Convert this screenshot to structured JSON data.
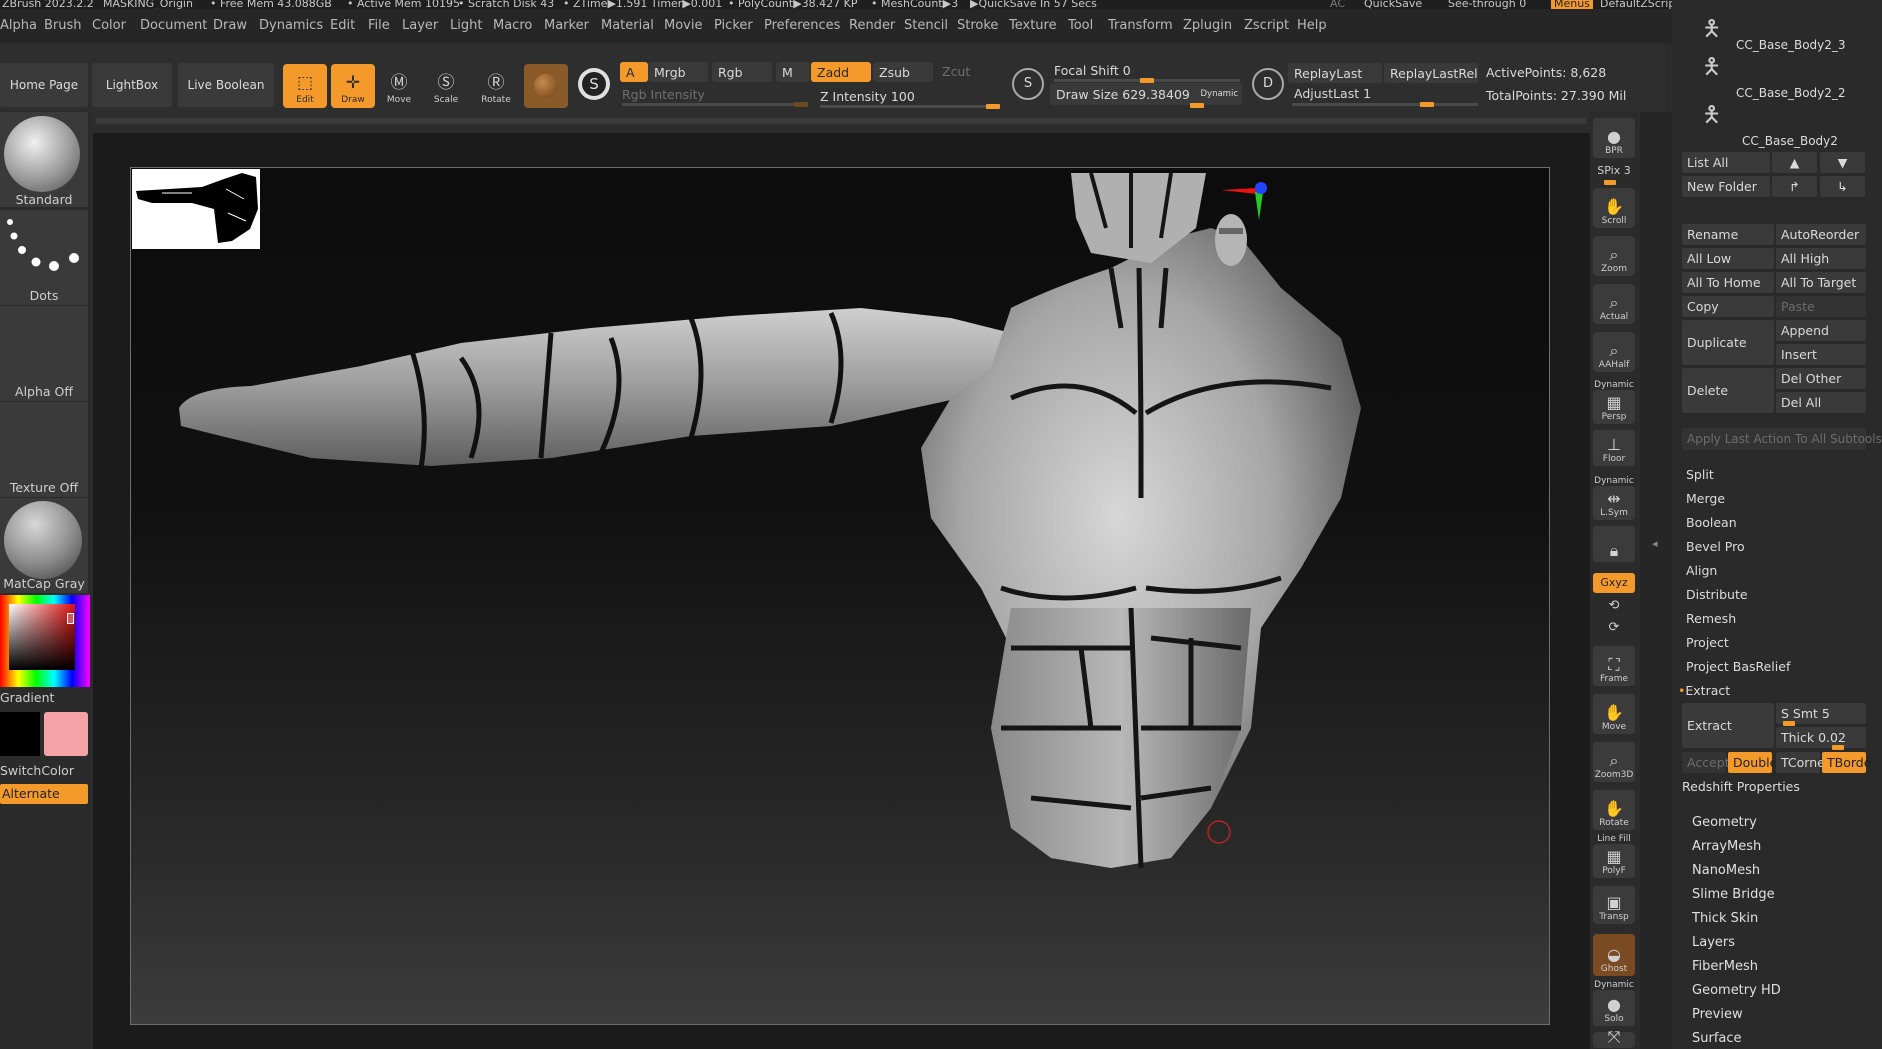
{
  "status": {
    "app": "ZBrush 2023.2.2",
    "file": "MASKING_Origin",
    "free_mem": "• Free Mem 43.088GB",
    "active_mem": "• Active Mem 10195",
    "scratch": "• Scratch Disk 43",
    "ztime": "• ZTime▶1.591 Timer▶0.001",
    "polycount": "• PolyCount▶38.427 KP",
    "meshcount": "• MeshCount▶3",
    "quicksave": "▶QuickSave In 57 Secs",
    "ac": "AC",
    "quicksave_btn": "QuickSave",
    "seethrough": "See-through 0",
    "menus": "Menus",
    "script": "DefaultZScript"
  },
  "menu": [
    "Alpha",
    "Brush",
    "Color",
    "Document",
    "Draw",
    "Dynamics",
    "Edit",
    "File",
    "Layer",
    "Light",
    "Macro",
    "Marker",
    "Material",
    "Movie",
    "Picker",
    "Preferences",
    "Render",
    "Stencil",
    "Stroke",
    "Texture",
    "Tool",
    "Transform",
    "Zplugin",
    "Zscript",
    "Help"
  ],
  "toolbar": {
    "home_page": "Home Page",
    "lightbox": "LightBox",
    "live_boolean": "Live Boolean",
    "edit": "Edit",
    "draw": "Draw",
    "move": "Move",
    "scale": "Scale",
    "rotate": "Rotate",
    "a": "A",
    "mrgb": "Mrgb",
    "rgb": "Rgb",
    "m": "M",
    "zadd": "Zadd",
    "zsub": "Zsub",
    "zcut": "Zcut",
    "rgb_intensity": "Rgb Intensity",
    "z_intensity": "Z Intensity 100",
    "focal_shift": "Focal Shift 0",
    "draw_size": "Draw Size 629.38409",
    "dynamic": "Dynamic",
    "replay_last": "ReplayLast",
    "replay_last_rel": "ReplayLastRel",
    "adjust_last": "AdjustLast 1",
    "active_points": "ActivePoints: 8,628",
    "total_points": "TotalPoints: 27.390 Mil"
  },
  "left": {
    "brush": "Standard",
    "stroke": "Dots",
    "alpha": "Alpha Off",
    "texture": "Texture Off",
    "material": "MatCap Gray",
    "gradient": "Gradient",
    "switch_color": "SwitchColor",
    "alternate": "Alternate",
    "primary_color": "#000000",
    "secondary_color": "#f5a3a6"
  },
  "shelf": {
    "bpr": "BPR",
    "spix": "SPix 3",
    "scroll": "Scroll",
    "zoom": "Zoom",
    "actual": "Actual",
    "aahalf": "AAHalf",
    "dynamic_persp": "Dynamic",
    "persp": "Persp",
    "floor": "Floor",
    "dynamic_lsym": "Dynamic",
    "lsym": "L.Sym",
    "xyz": "Gxyz",
    "frame": "Frame",
    "move": "Move",
    "zoom3d": "Zoom3D",
    "rotate": "Rotate",
    "line_fill": "Line Fill",
    "polyf": "PolyF",
    "transp": "Transp",
    "ghost": "Ghost",
    "dynamic_solo": "Dynamic",
    "solo": "Solo"
  },
  "right": {
    "subtools": [
      "CC_Base_Body2_3",
      "CC_Base_Body2_2",
      "CC_Base_Body2"
    ],
    "list_all": "List All",
    "new_folder": "New Folder",
    "rename": "Rename",
    "auto_reorder": "AutoReorder",
    "all_low": "All Low",
    "all_high": "All High",
    "all_to_home": "All To Home",
    "all_to_target": "All To Target",
    "copy": "Copy",
    "paste": "Paste",
    "duplicate": "Duplicate",
    "append": "Append",
    "insert": "Insert",
    "delete": "Delete",
    "del_other": "Del Other",
    "del_all": "Del All",
    "apply_last": "Apply Last Action To All Subtools",
    "split": "Split",
    "merge": "Merge",
    "boolean": "Boolean",
    "bevel_pro": "Bevel Pro",
    "align": "Align",
    "distribute": "Distribute",
    "remesh": "Remesh",
    "project": "Project",
    "project_basrelief": "Project BasRelief",
    "extract_section": "Extract",
    "extract": "Extract",
    "s_smt": "S Smt 5",
    "thick": "Thick 0.02",
    "accept": "Accept",
    "double": "Double",
    "tcorne": "TCorne",
    "tborde": "TBorde",
    "redshift": "Redshift Properties",
    "sections": [
      "Geometry",
      "ArrayMesh",
      "NanoMesh",
      "Slime Bridge",
      "Thick Skin",
      "Layers",
      "FiberMesh",
      "Geometry HD",
      "Preview",
      "Surface"
    ]
  },
  "colors": {
    "accent": "#f39a2b",
    "panel": "#2b2b2b",
    "button": "#3a3a3a"
  }
}
